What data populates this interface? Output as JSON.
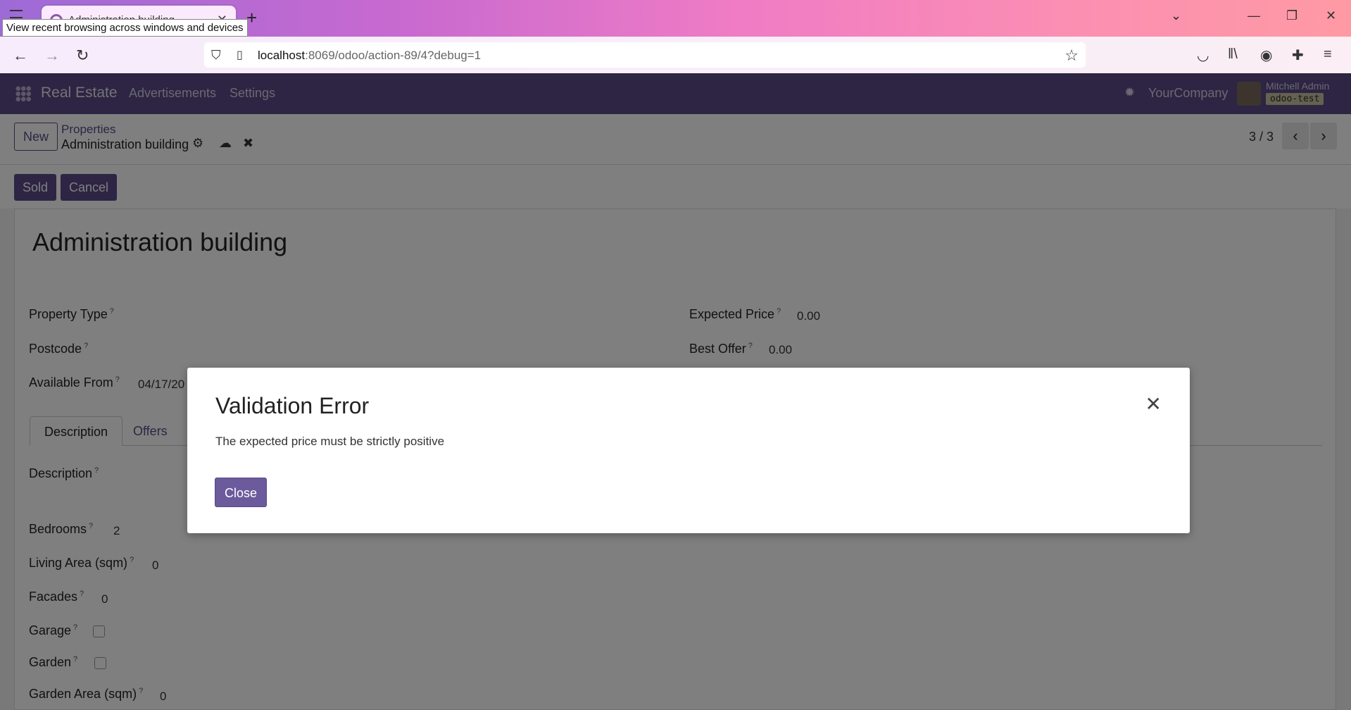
{
  "browser": {
    "tab_title": "Administration building",
    "tooltip": "View recent browsing across windows and devices",
    "url_host": "localhost",
    "url_rest": ":8069/odoo/action-89/4?debug=1"
  },
  "odoo": {
    "app_name": "Real Estate",
    "menu": [
      "Advertisements",
      "Settings"
    ],
    "company": "YourCompany",
    "user": "Mitchell Admin",
    "database": "odoo-test"
  },
  "control_panel": {
    "new_label": "New",
    "breadcrumb_parent": "Properties",
    "breadcrumb_current": "Administration building",
    "pager": "3 / 3"
  },
  "statusbar": {
    "sold_label": "Sold",
    "cancel_label": "Cancel"
  },
  "form": {
    "title": "Administration building",
    "property_type_label": "Property Type",
    "postcode_label": "Postcode",
    "available_from_label": "Available From",
    "available_from_value": "04/17/20",
    "expected_price_label": "Expected Price",
    "expected_price_value": "0.00",
    "best_offer_label": "Best Offer",
    "best_offer_value": "0.00",
    "tabs": [
      "Description",
      "Offers"
    ],
    "description_label": "Description",
    "bedrooms_label": "Bedrooms",
    "bedrooms_value": "2",
    "living_area_label": "Living Area (sqm)",
    "living_area_value": "0",
    "facades_label": "Facades",
    "facades_value": "0",
    "garage_label": "Garage",
    "garden_label": "Garden",
    "garden_area_label": "Garden Area (sqm)",
    "garden_area_value": "0",
    "help_mark": "?"
  },
  "dialog": {
    "title": "Validation Error",
    "message": "The expected price must be strictly positive",
    "close_label": "Close"
  }
}
